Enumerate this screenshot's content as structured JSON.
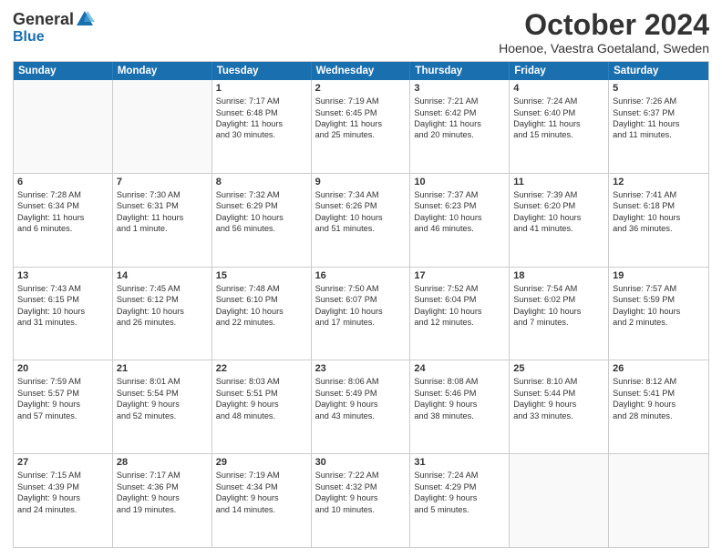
{
  "header": {
    "logo_general": "General",
    "logo_blue": "Blue",
    "month_title": "October 2024",
    "location": "Hoenoe, Vaestra Goetaland, Sweden"
  },
  "days_of_week": [
    "Sunday",
    "Monday",
    "Tuesday",
    "Wednesday",
    "Thursday",
    "Friday",
    "Saturday"
  ],
  "weeks": [
    [
      {
        "day": "",
        "info": [],
        "empty": true
      },
      {
        "day": "",
        "info": [],
        "empty": true
      },
      {
        "day": "1",
        "info": [
          "Sunrise: 7:17 AM",
          "Sunset: 6:48 PM",
          "Daylight: 11 hours",
          "and 30 minutes."
        ],
        "empty": false
      },
      {
        "day": "2",
        "info": [
          "Sunrise: 7:19 AM",
          "Sunset: 6:45 PM",
          "Daylight: 11 hours",
          "and 25 minutes."
        ],
        "empty": false
      },
      {
        "day": "3",
        "info": [
          "Sunrise: 7:21 AM",
          "Sunset: 6:42 PM",
          "Daylight: 11 hours",
          "and 20 minutes."
        ],
        "empty": false
      },
      {
        "day": "4",
        "info": [
          "Sunrise: 7:24 AM",
          "Sunset: 6:40 PM",
          "Daylight: 11 hours",
          "and 15 minutes."
        ],
        "empty": false
      },
      {
        "day": "5",
        "info": [
          "Sunrise: 7:26 AM",
          "Sunset: 6:37 PM",
          "Daylight: 11 hours",
          "and 11 minutes."
        ],
        "empty": false
      }
    ],
    [
      {
        "day": "6",
        "info": [
          "Sunrise: 7:28 AM",
          "Sunset: 6:34 PM",
          "Daylight: 11 hours",
          "and 6 minutes."
        ],
        "empty": false
      },
      {
        "day": "7",
        "info": [
          "Sunrise: 7:30 AM",
          "Sunset: 6:31 PM",
          "Daylight: 11 hours",
          "and 1 minute."
        ],
        "empty": false
      },
      {
        "day": "8",
        "info": [
          "Sunrise: 7:32 AM",
          "Sunset: 6:29 PM",
          "Daylight: 10 hours",
          "and 56 minutes."
        ],
        "empty": false
      },
      {
        "day": "9",
        "info": [
          "Sunrise: 7:34 AM",
          "Sunset: 6:26 PM",
          "Daylight: 10 hours",
          "and 51 minutes."
        ],
        "empty": false
      },
      {
        "day": "10",
        "info": [
          "Sunrise: 7:37 AM",
          "Sunset: 6:23 PM",
          "Daylight: 10 hours",
          "and 46 minutes."
        ],
        "empty": false
      },
      {
        "day": "11",
        "info": [
          "Sunrise: 7:39 AM",
          "Sunset: 6:20 PM",
          "Daylight: 10 hours",
          "and 41 minutes."
        ],
        "empty": false
      },
      {
        "day": "12",
        "info": [
          "Sunrise: 7:41 AM",
          "Sunset: 6:18 PM",
          "Daylight: 10 hours",
          "and 36 minutes."
        ],
        "empty": false
      }
    ],
    [
      {
        "day": "13",
        "info": [
          "Sunrise: 7:43 AM",
          "Sunset: 6:15 PM",
          "Daylight: 10 hours",
          "and 31 minutes."
        ],
        "empty": false
      },
      {
        "day": "14",
        "info": [
          "Sunrise: 7:45 AM",
          "Sunset: 6:12 PM",
          "Daylight: 10 hours",
          "and 26 minutes."
        ],
        "empty": false
      },
      {
        "day": "15",
        "info": [
          "Sunrise: 7:48 AM",
          "Sunset: 6:10 PM",
          "Daylight: 10 hours",
          "and 22 minutes."
        ],
        "empty": false
      },
      {
        "day": "16",
        "info": [
          "Sunrise: 7:50 AM",
          "Sunset: 6:07 PM",
          "Daylight: 10 hours",
          "and 17 minutes."
        ],
        "empty": false
      },
      {
        "day": "17",
        "info": [
          "Sunrise: 7:52 AM",
          "Sunset: 6:04 PM",
          "Daylight: 10 hours",
          "and 12 minutes."
        ],
        "empty": false
      },
      {
        "day": "18",
        "info": [
          "Sunrise: 7:54 AM",
          "Sunset: 6:02 PM",
          "Daylight: 10 hours",
          "and 7 minutes."
        ],
        "empty": false
      },
      {
        "day": "19",
        "info": [
          "Sunrise: 7:57 AM",
          "Sunset: 5:59 PM",
          "Daylight: 10 hours",
          "and 2 minutes."
        ],
        "empty": false
      }
    ],
    [
      {
        "day": "20",
        "info": [
          "Sunrise: 7:59 AM",
          "Sunset: 5:57 PM",
          "Daylight: 9 hours",
          "and 57 minutes."
        ],
        "empty": false
      },
      {
        "day": "21",
        "info": [
          "Sunrise: 8:01 AM",
          "Sunset: 5:54 PM",
          "Daylight: 9 hours",
          "and 52 minutes."
        ],
        "empty": false
      },
      {
        "day": "22",
        "info": [
          "Sunrise: 8:03 AM",
          "Sunset: 5:51 PM",
          "Daylight: 9 hours",
          "and 48 minutes."
        ],
        "empty": false
      },
      {
        "day": "23",
        "info": [
          "Sunrise: 8:06 AM",
          "Sunset: 5:49 PM",
          "Daylight: 9 hours",
          "and 43 minutes."
        ],
        "empty": false
      },
      {
        "day": "24",
        "info": [
          "Sunrise: 8:08 AM",
          "Sunset: 5:46 PM",
          "Daylight: 9 hours",
          "and 38 minutes."
        ],
        "empty": false
      },
      {
        "day": "25",
        "info": [
          "Sunrise: 8:10 AM",
          "Sunset: 5:44 PM",
          "Daylight: 9 hours",
          "and 33 minutes."
        ],
        "empty": false
      },
      {
        "day": "26",
        "info": [
          "Sunrise: 8:12 AM",
          "Sunset: 5:41 PM",
          "Daylight: 9 hours",
          "and 28 minutes."
        ],
        "empty": false
      }
    ],
    [
      {
        "day": "27",
        "info": [
          "Sunrise: 7:15 AM",
          "Sunset: 4:39 PM",
          "Daylight: 9 hours",
          "and 24 minutes."
        ],
        "empty": false
      },
      {
        "day": "28",
        "info": [
          "Sunrise: 7:17 AM",
          "Sunset: 4:36 PM",
          "Daylight: 9 hours",
          "and 19 minutes."
        ],
        "empty": false
      },
      {
        "day": "29",
        "info": [
          "Sunrise: 7:19 AM",
          "Sunset: 4:34 PM",
          "Daylight: 9 hours",
          "and 14 minutes."
        ],
        "empty": false
      },
      {
        "day": "30",
        "info": [
          "Sunrise: 7:22 AM",
          "Sunset: 4:32 PM",
          "Daylight: 9 hours",
          "and 10 minutes."
        ],
        "empty": false
      },
      {
        "day": "31",
        "info": [
          "Sunrise: 7:24 AM",
          "Sunset: 4:29 PM",
          "Daylight: 9 hours",
          "and 5 minutes."
        ],
        "empty": false
      },
      {
        "day": "",
        "info": [],
        "empty": true
      },
      {
        "day": "",
        "info": [],
        "empty": true
      }
    ]
  ]
}
